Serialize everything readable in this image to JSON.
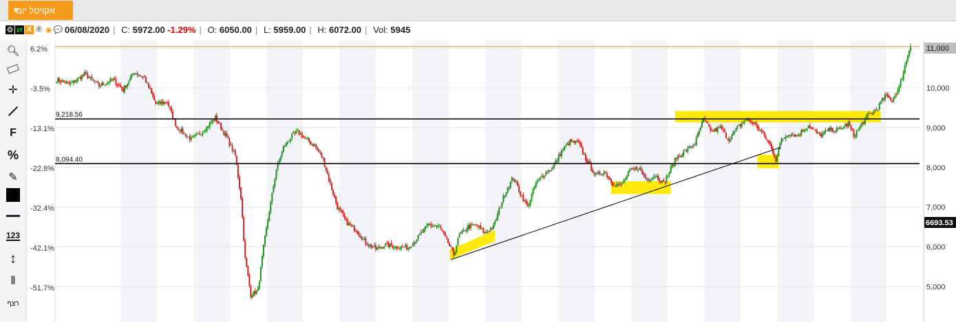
{
  "tab": {
    "title": "אקויטל יומי",
    "close_label": "×"
  },
  "infobar": {
    "date": "06/08/2020",
    "close_label": "C:",
    "close_value": "5972.00",
    "change": "-1.29%",
    "open_label": "O:",
    "open_value": "6050.00",
    "low_label": "L:",
    "low_value": "5959.00",
    "high_label": "H:",
    "high_value": "6072.00",
    "vol_label": "Vol:",
    "vol_value": "5945"
  },
  "toolbar": {
    "icons": [
      "settings-icon",
      "share-icon",
      "excel-icon",
      "registered-icon",
      "target-icon",
      "comment-icon"
    ],
    "tools": [
      {
        "name": "zoom-tool",
        "glyph": "🔍"
      },
      {
        "name": "eraser-tool",
        "glyph": "⌫"
      },
      {
        "name": "crosshair-tool",
        "glyph": "✛"
      },
      {
        "name": "line-tool",
        "glyph": "╱"
      },
      {
        "name": "fibonacci-tool",
        "glyph": "F"
      },
      {
        "name": "percent-tool",
        "glyph": "%"
      },
      {
        "name": "edit-tool",
        "glyph": "✎"
      },
      {
        "name": "fill-color-tool",
        "glyph": "■"
      },
      {
        "name": "line-style-tool",
        "glyph": "━"
      },
      {
        "name": "number-format-tool",
        "glyph": "123"
      },
      {
        "name": "vertical-measure-tool",
        "glyph": "↕"
      },
      {
        "name": "candle-type-tool",
        "glyph": "⫴"
      }
    ],
    "bottom_label": "רצף"
  },
  "chart_data": {
    "type": "candlestick",
    "title": "",
    "ylim": [
      4600,
      11300
    ],
    "price_ticks": [
      5000,
      6000,
      7000,
      8000,
      9000,
      10000,
      11000
    ],
    "price_tick_labels": [
      "5,000",
      "6,000",
      "7,000",
      "8,000",
      "9,000",
      "10,000",
      "11,000"
    ],
    "percent_ticks": [
      6.2,
      -3.5,
      -13.1,
      -22.8,
      -32.4,
      -42.1,
      -51.7
    ],
    "percent_tick_labels": [
      "6.2%",
      "-3.5%",
      "-13.1%",
      "-22.8%",
      "-32.4%",
      "-42.1%",
      "-51.7%"
    ],
    "last_price_marker": "11,000",
    "cursor_price_marker": "6693.53",
    "horizontal_lines": [
      {
        "value": 9218.56,
        "label": "9,218.56"
      },
      {
        "value": 8094.4,
        "label": "8,094.40"
      }
    ],
    "max_line_value": 11040,
    "trendline": {
      "from_index": 278,
      "from_price": 5680,
      "to_index": 510,
      "to_price": 8500
    },
    "highlights": [
      {
        "from_index": 278,
        "to_index": 308,
        "low": 5680,
        "high": 6250
      },
      {
        "from_index": 392,
        "to_index": 432,
        "low": 7400,
        "high": 7580
      },
      {
        "from_index": 437,
        "to_index": 580,
        "low": 9200,
        "high": 9350
      },
      {
        "from_index": 495,
        "to_index": 508,
        "low": 8050,
        "high": 8250
      }
    ],
    "colors": {
      "up": "#1a8f1a",
      "down": "#d62020",
      "highlight": "#ffe800",
      "max_line": "#c8a040",
      "band": "#f2f4f7"
    },
    "anchors": [
      [
        0,
        10200
      ],
      [
        10,
        10100
      ],
      [
        20,
        10350
      ],
      [
        30,
        10050
      ],
      [
        40,
        10200
      ],
      [
        47,
        9950
      ],
      [
        55,
        10400
      ],
      [
        62,
        10250
      ],
      [
        70,
        9600
      ],
      [
        78,
        9650
      ],
      [
        85,
        9000
      ],
      [
        95,
        8700
      ],
      [
        103,
        8900
      ],
      [
        112,
        9250
      ],
      [
        120,
        8750
      ],
      [
        126,
        8300
      ],
      [
        130,
        7250
      ],
      [
        133,
        5700
      ],
      [
        137,
        4800
      ],
      [
        142,
        4900
      ],
      [
        146,
        6000
      ],
      [
        150,
        6900
      ],
      [
        155,
        7950
      ],
      [
        160,
        8500
      ],
      [
        165,
        8750
      ],
      [
        170,
        8900
      ],
      [
        176,
        8700
      ],
      [
        182,
        8550
      ],
      [
        188,
        8200
      ],
      [
        192,
        7700
      ],
      [
        198,
        7000
      ],
      [
        205,
        6600
      ],
      [
        212,
        6400
      ],
      [
        218,
        6100
      ],
      [
        225,
        5950
      ],
      [
        232,
        6050
      ],
      [
        240,
        6000
      ],
      [
        248,
        5980
      ],
      [
        255,
        6250
      ],
      [
        262,
        6550
      ],
      [
        270,
        6500
      ],
      [
        276,
        6100
      ],
      [
        280,
        5800
      ],
      [
        284,
        6300
      ],
      [
        290,
        6500
      ],
      [
        296,
        6550
      ],
      [
        302,
        6350
      ],
      [
        308,
        6500
      ],
      [
        316,
        7350
      ],
      [
        322,
        7750
      ],
      [
        327,
        7350
      ],
      [
        332,
        7000
      ],
      [
        338,
        7600
      ],
      [
        344,
        7850
      ],
      [
        350,
        8000
      ],
      [
        356,
        8400
      ],
      [
        362,
        8650
      ],
      [
        368,
        8600
      ],
      [
        374,
        8150
      ],
      [
        380,
        7800
      ],
      [
        386,
        7900
      ],
      [
        392,
        7600
      ],
      [
        398,
        7550
      ],
      [
        404,
        7900
      ],
      [
        410,
        8000
      ],
      [
        416,
        7700
      ],
      [
        422,
        7800
      ],
      [
        428,
        7600
      ],
      [
        432,
        7900
      ],
      [
        437,
        8250
      ],
      [
        443,
        8400
      ],
      [
        450,
        8600
      ],
      [
        456,
        9200
      ],
      [
        462,
        8900
      ],
      [
        468,
        9000
      ],
      [
        474,
        8700
      ],
      [
        480,
        9000
      ],
      [
        486,
        9200
      ],
      [
        492,
        9100
      ],
      [
        498,
        8850
      ],
      [
        503,
        8550
      ],
      [
        507,
        8200
      ],
      [
        511,
        8700
      ],
      [
        516,
        8850
      ],
      [
        522,
        8800
      ],
      [
        530,
        9050
      ],
      [
        538,
        8800
      ],
      [
        545,
        8950
      ],
      [
        552,
        8950
      ],
      [
        558,
        9100
      ],
      [
        562,
        8800
      ],
      [
        566,
        9000
      ],
      [
        572,
        9300
      ],
      [
        578,
        9450
      ],
      [
        584,
        9800
      ],
      [
        589,
        9700
      ],
      [
        594,
        10000
      ],
      [
        598,
        10550
      ],
      [
        602,
        11100
      ]
    ]
  }
}
